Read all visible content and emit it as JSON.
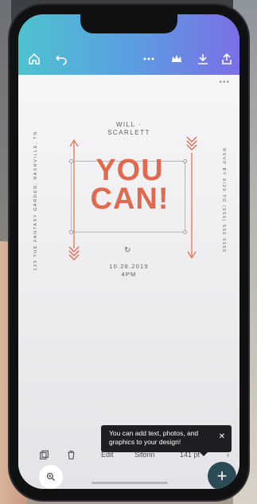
{
  "toolbar": {
    "icons": [
      "home-icon",
      "undo-icon",
      "more-icon",
      "crown-icon",
      "download-icon",
      "share-icon"
    ]
  },
  "design": {
    "org_name": "WILL · SCARLETT",
    "side_left": "123 THE FANTASY GARDEN, NASHVILLE, TN",
    "side_right": "RSVP BY 8/20 TO (555) 555 5555",
    "headline": "YOU CAN!",
    "date": "10.28.2019",
    "time": "4PM",
    "accent_color": "#e06a4e"
  },
  "toast": {
    "message": "You can add text, photos, and graphics to your design!"
  },
  "bottom_bar": {
    "edit_label": "Edit",
    "font_label": "Sifonn",
    "size_label": "141 pt"
  }
}
